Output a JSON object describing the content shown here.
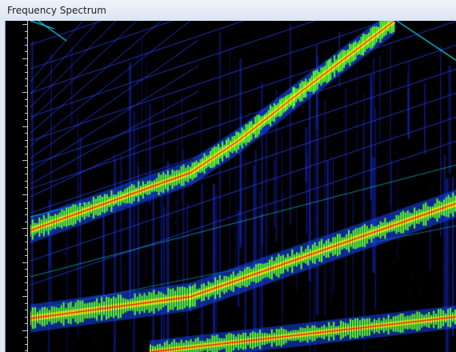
{
  "window": {
    "title": "Frequency Spectrum"
  },
  "spectrogram": {
    "colors": {
      "background": "#000000",
      "low": "#1020a0",
      "mid_low": "#1848ff",
      "mid": "#18d8ff",
      "mid_high": "#60ff20",
      "high": "#ffff00",
      "peak": "#ff2000",
      "ruler_tick": "#c8c8c8"
    }
  }
}
